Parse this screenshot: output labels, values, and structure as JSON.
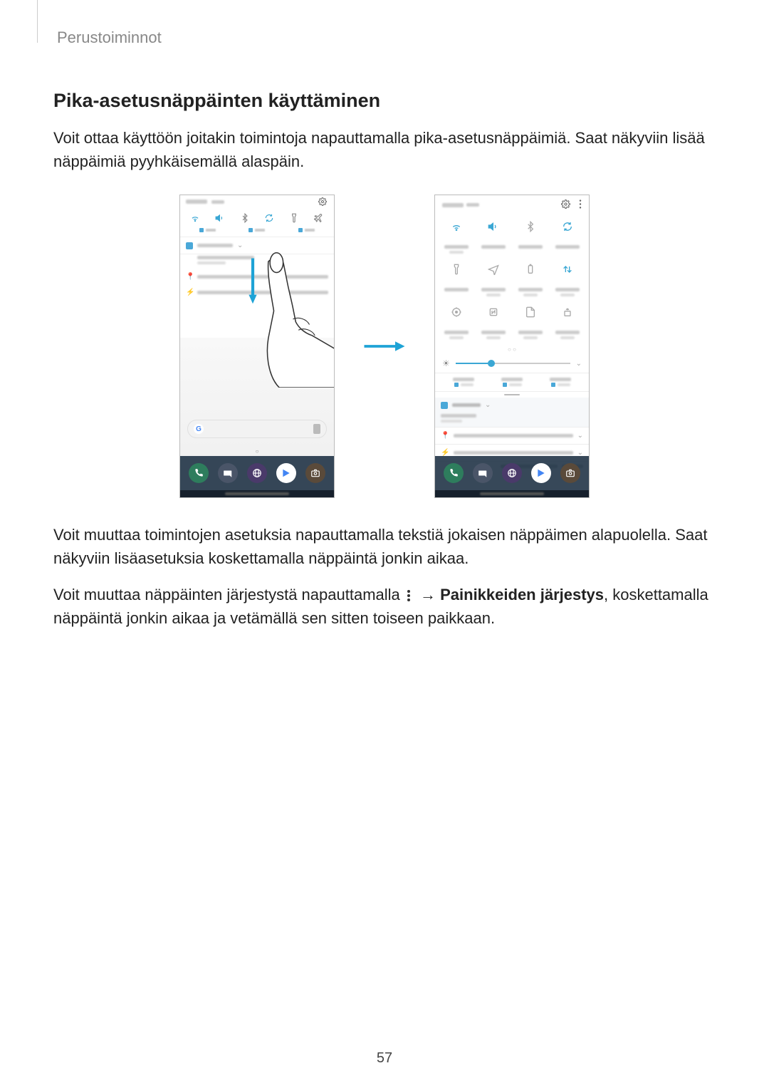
{
  "breadcrumb": "Perustoiminnot",
  "heading": "Pika-asetusnäppäinten käyttäminen",
  "para1": "Voit ottaa käyttöön joitakin toimintoja napauttamalla pika-asetusnäppäimiä. Saat näkyviin lisää näppäimiä pyyhkäisemällä alaspäin.",
  "para2": "Voit muuttaa toimintojen asetuksia napauttamalla tekstiä jokaisen näppäimen alapuolella. Saat näkyviin lisäasetuksia koskettamalla näppäintä jonkin aikaa.",
  "para3_a": "Voit muuttaa näppäinten järjestystä napauttamalla ",
  "para3_b": " → ",
  "para3_c": "Painikkeiden järjestys",
  "para3_d": ", koskettamalla näppäintä jonkin aikaa ja vetämällä sen sitten toiseen paikkaan.",
  "page_number": "57",
  "icons": {
    "wifi": "wifi",
    "speaker": "speaker",
    "bluetooth": "bluetooth",
    "rotate": "rotate",
    "flashlight": "flashlight",
    "airplane": "airplane",
    "location": "location",
    "power": "power",
    "datasaver": "datasaver",
    "nfc": "nfc",
    "file": "file",
    "updown": "updown",
    "hotspot": "hotspot",
    "gear": "gear",
    "more": "more",
    "phone": "phone",
    "message": "message",
    "browser": "browser",
    "play": "play",
    "camera": "camera"
  }
}
